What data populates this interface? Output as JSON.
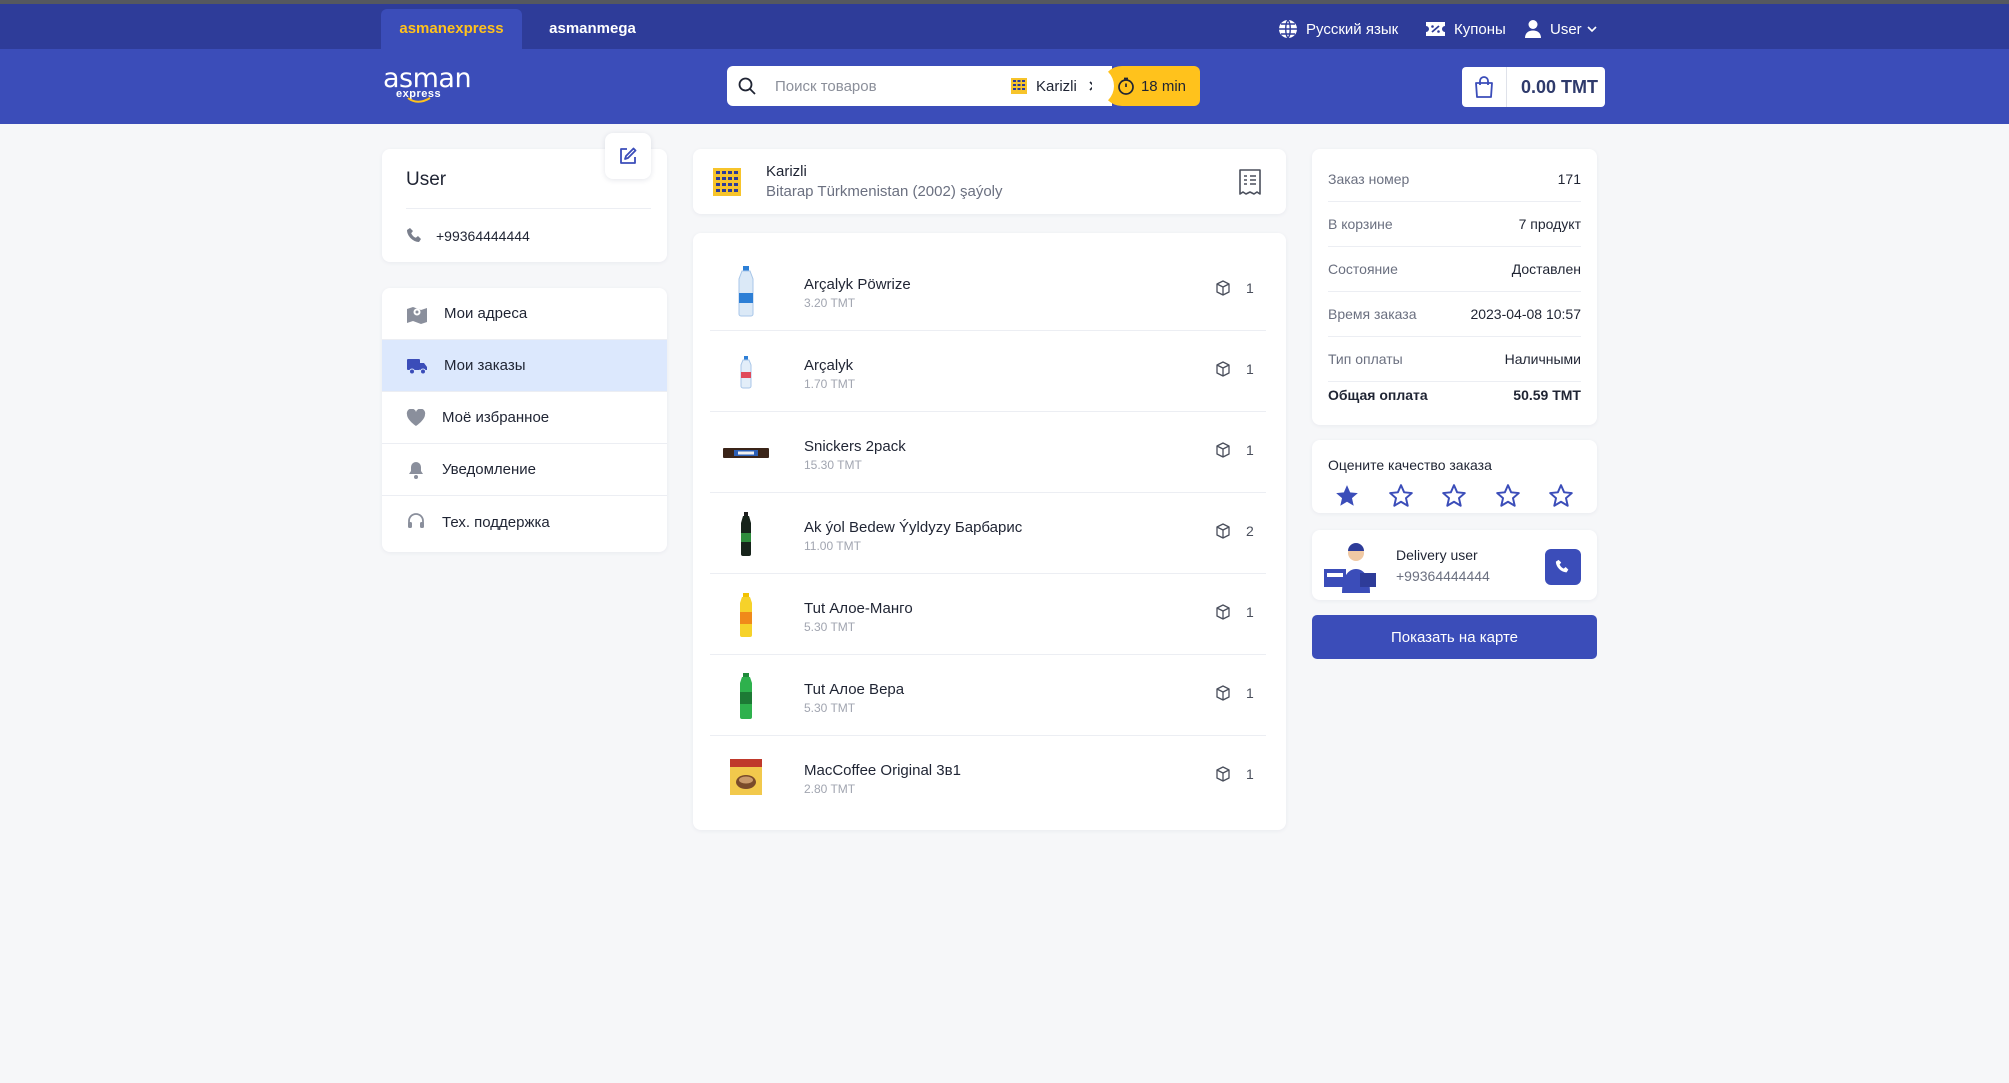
{
  "topbar": {
    "tabs": [
      {
        "label": "asmanexpress",
        "active": true
      },
      {
        "label": "asmanmega",
        "active": false
      }
    ],
    "language_label": "Русский язык",
    "coupons_label": "Купоны",
    "user_label": "User"
  },
  "header": {
    "logo_text": "asman",
    "logo_sub": "express",
    "search_placeholder": "Поиск товаров",
    "store_label": "Karizli",
    "eta_label": "18 min",
    "cart_total": "0.00 TMT"
  },
  "profile": {
    "name": "User",
    "phone": "+99364444444"
  },
  "menu": {
    "items": [
      {
        "label": "Мои адреса",
        "icon": "map-icon"
      },
      {
        "label": "Мои заказы",
        "icon": "truck-icon",
        "active": true
      },
      {
        "label": "Моё избранное",
        "icon": "heart-icon"
      },
      {
        "label": "Уведомление",
        "icon": "bell-icon"
      },
      {
        "label": "Тех. поддержка",
        "icon": "headset-icon"
      }
    ]
  },
  "store": {
    "name": "Karizli",
    "address": "Bitarap Türkmenistan (2002) şaýoly"
  },
  "products": [
    {
      "name": "Arçalyk Pöwrize",
      "price": "3.20 TMT",
      "qty": "1",
      "kind": "water-tall"
    },
    {
      "name": "Arçalyk",
      "price": "1.70 TMT",
      "qty": "1",
      "kind": "water-small"
    },
    {
      "name": "Snickers 2pack",
      "price": "15.30 TMT",
      "qty": "1",
      "kind": "chocolate-bar"
    },
    {
      "name": "Ak ýol Bedew Ýyldyzy Барбарис",
      "price": "11.00 TMT",
      "qty": "2",
      "kind": "dark-bottle"
    },
    {
      "name": "Tut Алое-Манго",
      "price": "5.30 TMT",
      "qty": "1",
      "kind": "yellow-bottle"
    },
    {
      "name": "Tut Алое Вера",
      "price": "5.30 TMT",
      "qty": "1",
      "kind": "green-bottle"
    },
    {
      "name": "MacCoffee Original 3в1",
      "price": "2.80 TMT",
      "qty": "1",
      "kind": "coffee-pack"
    }
  ],
  "order": {
    "rows": [
      {
        "label": "Заказ номер",
        "value": "171"
      },
      {
        "label": "В корзине",
        "value": "7 продукт"
      },
      {
        "label": "Состояние",
        "value": "Доставлен"
      },
      {
        "label": "Время заказа",
        "value": "2023-04-08 10:57"
      },
      {
        "label": "Тип оплаты",
        "value": "Наличными"
      },
      {
        "label": "Общая оплата",
        "value": "50.59 TMT",
        "total": true
      }
    ]
  },
  "rating": {
    "title": "Оцените качество заказа",
    "value": 1,
    "max": 5
  },
  "courier": {
    "name": "Delivery user",
    "phone": "+99364444444"
  },
  "map_button_label": "Показать на карте",
  "colors": {
    "brand_blue": "#3b4db9",
    "brand_dark": "#2e3c99",
    "accent_yellow": "#ffc21c",
    "active_menu_bg": "#dce8fd"
  }
}
